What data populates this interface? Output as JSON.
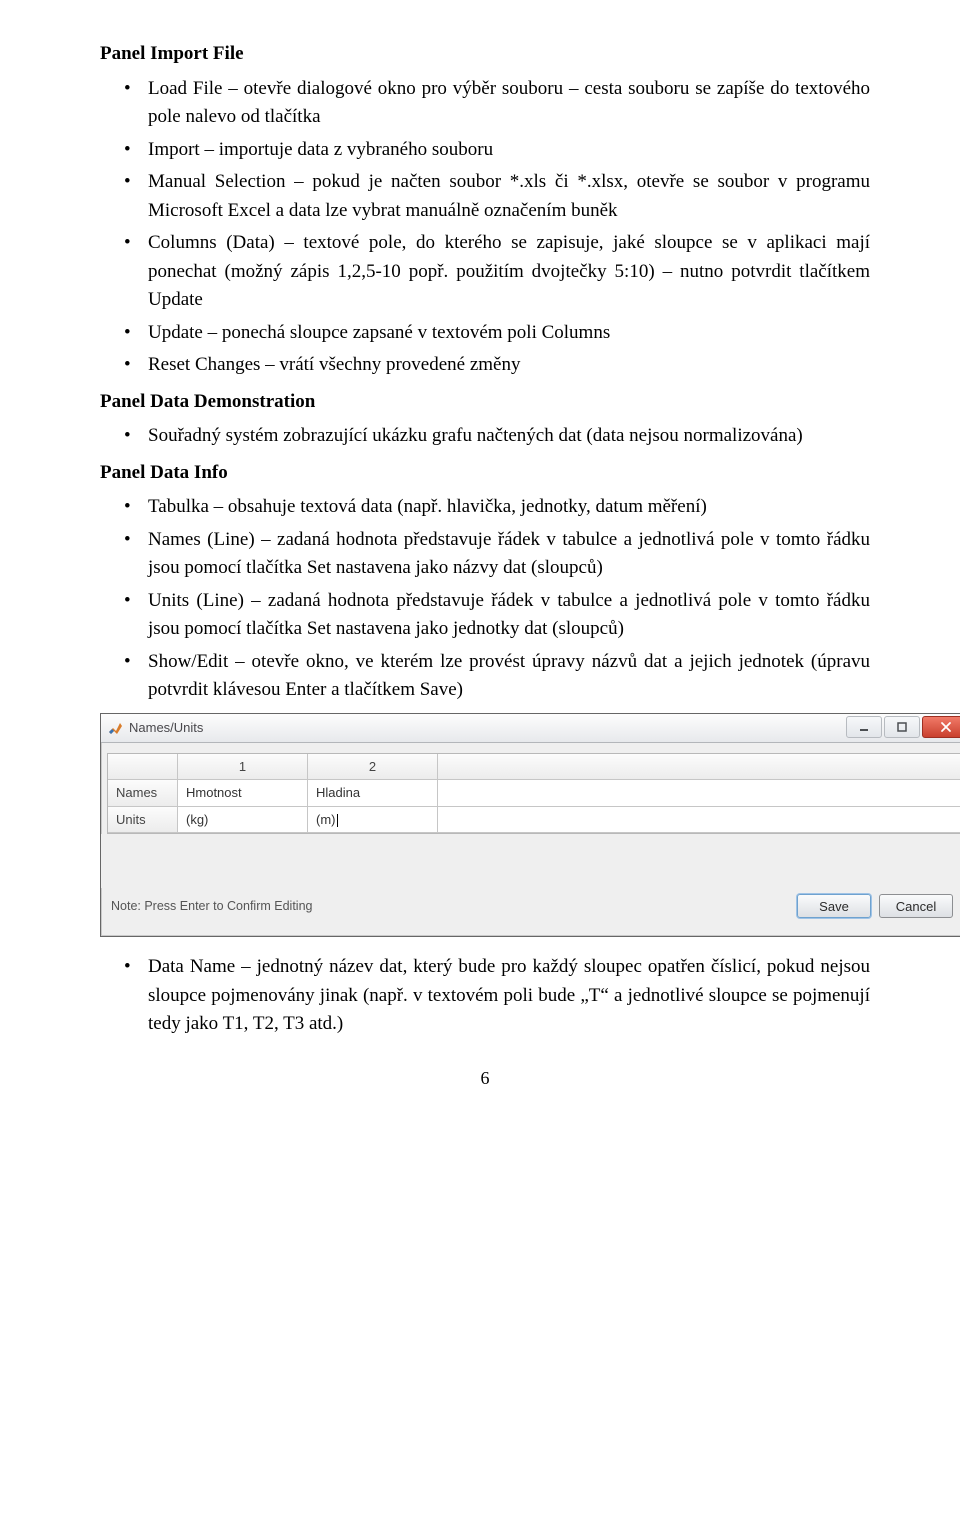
{
  "sec1": {
    "title": "Panel Import File",
    "items": [
      "Load File – otevře dialogové okno pro výběr souboru – cesta souboru se zapíše do textového pole nalevo od tlačítka",
      "Import – importuje data z vybraného souboru",
      "Manual Selection – pokud je načten soubor *.xls či *.xlsx, otevře se soubor v programu Microsoft Excel a data lze vybrat manuálně označením buněk",
      "Columns (Data) – textové pole, do kterého se zapisuje, jaké sloupce se v aplikaci mají ponechat (možný zápis 1,2,5-10 popř. použitím dvojtečky 5:10) – nutno potvrdit tlačítkem Update",
      "Update – ponechá sloupce zapsané v textovém poli Columns",
      "Reset Changes – vrátí všechny provedené změny"
    ]
  },
  "sec2": {
    "title": "Panel Data Demonstration",
    "items": [
      "Souřadný systém zobrazující ukázku grafu načtených dat (data nejsou normalizována)"
    ]
  },
  "sec3": {
    "title": "Panel Data Info",
    "items": [
      "Tabulka – obsahuje textová data (např. hlavička, jednotky, datum měření)",
      "Names (Line) – zadaná hodnota představuje řádek v tabulce a jednotlivá pole v tomto řádku jsou pomocí tlačítka Set nastavena jako názvy dat (sloupců)",
      "Units (Line) – zadaná hodnota představuje řádek v tabulce a jednotlivá pole v tomto řádku jsou pomocí tlačítka Set nastavena jako jednotky dat (sloupců)",
      "Show/Edit – otevře okno, ve kterém lze provést úpravy názvů dat a jejich jednotek (úpravu potvrdit klávesou Enter a tlačítkem Save)"
    ],
    "after_items": [
      "Data Name – jednotný název dat, který bude pro každý sloupec opatřen číslicí, pokud nejsou sloupce pojmenovány jinak (např. v textovém poli bude „T“ a jednotlivé sloupce se pojmenují tedy jako T1, T2, T3 atd.)"
    ]
  },
  "window": {
    "title": "Names/Units",
    "col_headers": [
      "",
      "1",
      "2"
    ],
    "rows": [
      {
        "label": "Names",
        "c1": "Hmotnost",
        "c2": "Hladina"
      },
      {
        "label": "Units",
        "c1": "(kg)",
        "c2": "(m)"
      }
    ],
    "note": "Note: Press Enter to Confirm Editing",
    "save": "Save",
    "cancel": "Cancel"
  },
  "page_number": "6"
}
